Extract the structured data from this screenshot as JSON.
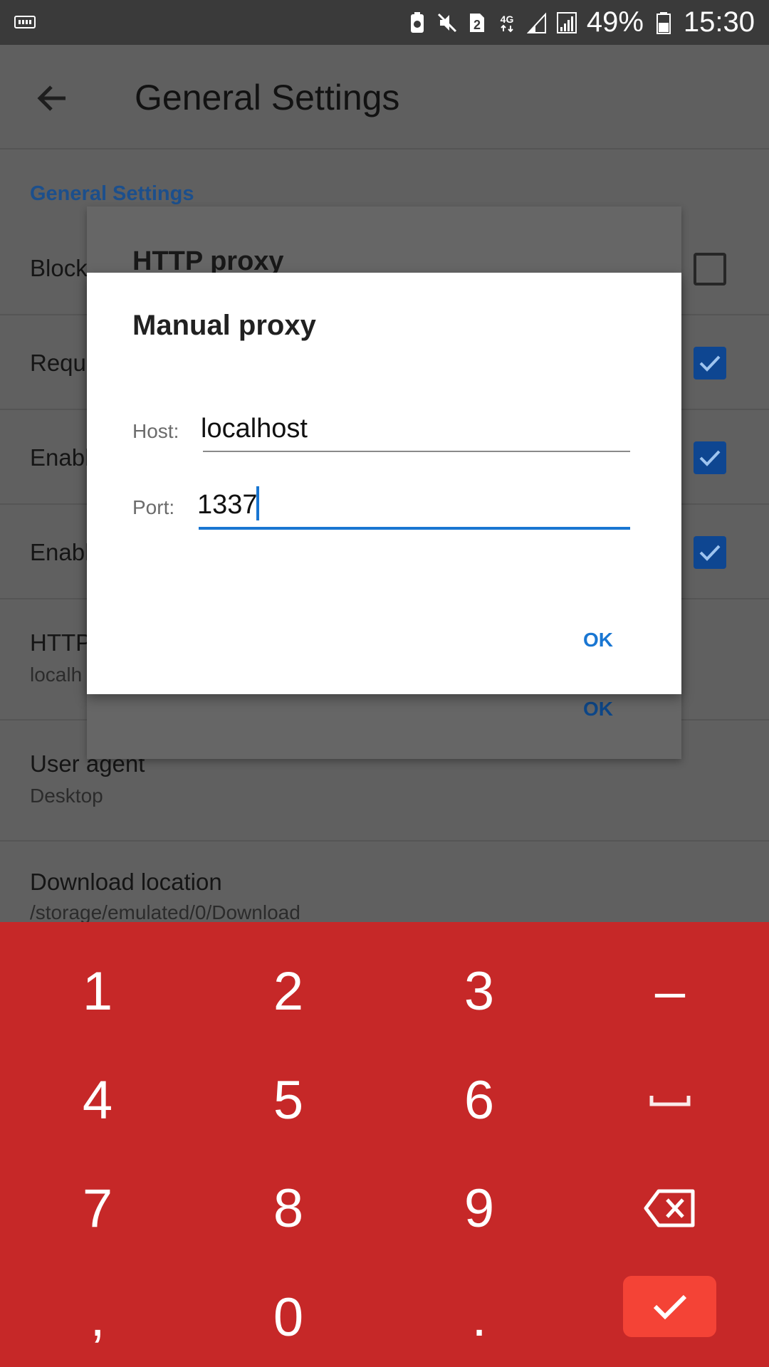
{
  "status_bar": {
    "battery_percent": "49%",
    "time": "15:30",
    "sim_badge": "2",
    "network": "4G",
    "icons": [
      "keyboard-icon",
      "battery-saver-icon",
      "mute-icon",
      "sim-2-icon",
      "4g-data-icon",
      "signal-icon",
      "signal-icon",
      "battery-icon"
    ]
  },
  "app_bar": {
    "title": "General Settings",
    "back_icon": "arrow-back-icon"
  },
  "settings": {
    "section_title": "General Settings",
    "rows": [
      {
        "title": "Block",
        "checked": false
      },
      {
        "title": "Reque",
        "checked": true
      },
      {
        "title": "Enabl",
        "checked": true
      },
      {
        "title": "Enabl",
        "checked": true
      },
      {
        "title": "HTTP",
        "subtitle": "localh"
      },
      {
        "title": "User agent",
        "subtitle": "Desktop"
      },
      {
        "title": "Download location",
        "subtitle": "/storage/emulated/0/Download"
      }
    ]
  },
  "back_dialog": {
    "title": "HTTP proxy",
    "ok_label": "OK"
  },
  "dialog": {
    "title": "Manual proxy",
    "host_label": "Host:",
    "host_value": "localhost",
    "port_label": "Port:",
    "port_value": "1337",
    "ok_label": "OK"
  },
  "keypad": {
    "keys": [
      "1",
      "2",
      "3",
      "–",
      "4",
      "5",
      "6",
      "space",
      "7",
      "8",
      "9",
      "backspace",
      ",",
      "0",
      ".",
      "done"
    ],
    "colors": {
      "background": "#c62828",
      "done_button": "#f44336"
    }
  }
}
